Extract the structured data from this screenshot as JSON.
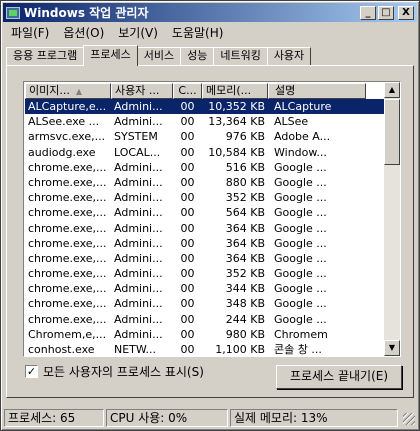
{
  "window": {
    "title": "Windows 작업 관리자",
    "buttons": {
      "minimize": "_",
      "maximize": "□",
      "close": "X"
    }
  },
  "menu": [
    "파일(F)",
    "옵션(O)",
    "보기(V)",
    "도움말(H)"
  ],
  "tabs": [
    {
      "label": "응용 프로그램",
      "active": false
    },
    {
      "label": "프로세스",
      "active": true
    },
    {
      "label": "서비스",
      "active": false
    },
    {
      "label": "성능",
      "active": false
    },
    {
      "label": "네트워킹",
      "active": false
    },
    {
      "label": "사용자",
      "active": false
    }
  ],
  "columns": {
    "image": "이미지...",
    "user": "사용자 ...",
    "cpu": "C...",
    "memory": "메모리(...",
    "description": "설명"
  },
  "processes": [
    {
      "image": "ALCapture,e...",
      "user": "Admini...",
      "cpu": "00",
      "memory": "10,352 KB",
      "description": "ALCapture",
      "selected": true
    },
    {
      "image": "ALSee.exe ...",
      "user": "Admini...",
      "cpu": "00",
      "memory": "13,364 KB",
      "description": "ALSee",
      "selected": false
    },
    {
      "image": "armsvc.exe,...",
      "user": "SYSTEM",
      "cpu": "00",
      "memory": "976 KB",
      "description": "Adobe A...",
      "selected": false
    },
    {
      "image": "audiodg.exe",
      "user": "LOCAL...",
      "cpu": "00",
      "memory": "10,584 KB",
      "description": "Window...",
      "selected": false
    },
    {
      "image": "chrome.exe,...",
      "user": "Admini...",
      "cpu": "00",
      "memory": "516 KB",
      "description": "Google ...",
      "selected": false
    },
    {
      "image": "chrome.exe,...",
      "user": "Admini...",
      "cpu": "00",
      "memory": "880 KB",
      "description": "Google ...",
      "selected": false
    },
    {
      "image": "chrome.exe,...",
      "user": "Admini...",
      "cpu": "00",
      "memory": "352 KB",
      "description": "Google ...",
      "selected": false
    },
    {
      "image": "chrome.exe,...",
      "user": "Admini...",
      "cpu": "00",
      "memory": "564 KB",
      "description": "Google ...",
      "selected": false
    },
    {
      "image": "chrome.exe,...",
      "user": "Admini...",
      "cpu": "00",
      "memory": "364 KB",
      "description": "Google ...",
      "selected": false
    },
    {
      "image": "chrome.exe,...",
      "user": "Admini...",
      "cpu": "00",
      "memory": "364 KB",
      "description": "Google ...",
      "selected": false
    },
    {
      "image": "chrome.exe,...",
      "user": "Admini...",
      "cpu": "00",
      "memory": "364 KB",
      "description": "Google ...",
      "selected": false
    },
    {
      "image": "chrome.exe,...",
      "user": "Admini...",
      "cpu": "00",
      "memory": "352 KB",
      "description": "Google ...",
      "selected": false
    },
    {
      "image": "chrome.exe,...",
      "user": "Admini...",
      "cpu": "00",
      "memory": "344 KB",
      "description": "Google ...",
      "selected": false
    },
    {
      "image": "chrome.exe,...",
      "user": "Admini...",
      "cpu": "00",
      "memory": "348 KB",
      "description": "Google ...",
      "selected": false
    },
    {
      "image": "chrome.exe,...",
      "user": "Admini...",
      "cpu": "00",
      "memory": "244 KB",
      "description": "Google ...",
      "selected": false
    },
    {
      "image": "Chromem,e,...",
      "user": "Admini...",
      "cpu": "00",
      "memory": "980 KB",
      "description": "Chromem",
      "selected": false
    },
    {
      "image": "conhost.exe",
      "user": "NETW...",
      "cpu": "00",
      "memory": "1,100 KB",
      "description": "콘솔 창 ...",
      "selected": false
    }
  ],
  "show_all_users": {
    "label": "모든 사용자의 프로세스 표시(S)",
    "checked": true,
    "mark": "✓"
  },
  "end_process_button": "프로세스 끝내기(E)",
  "status": {
    "processes": "프로세스: 65",
    "cpu": "CPU 사용: 0%",
    "memory": "실제 메모리: 13%"
  },
  "colors": {
    "titlebar_start": "#0a246a",
    "titlebar_end": "#a6caf0",
    "selection": "#0a246a",
    "face": "#d4d0c8"
  },
  "icons": {
    "app": "task-manager-icon",
    "sort": "sort-ascending-icon",
    "scroll_up": "arrow-up-icon",
    "scroll_down": "arrow-down-icon"
  }
}
